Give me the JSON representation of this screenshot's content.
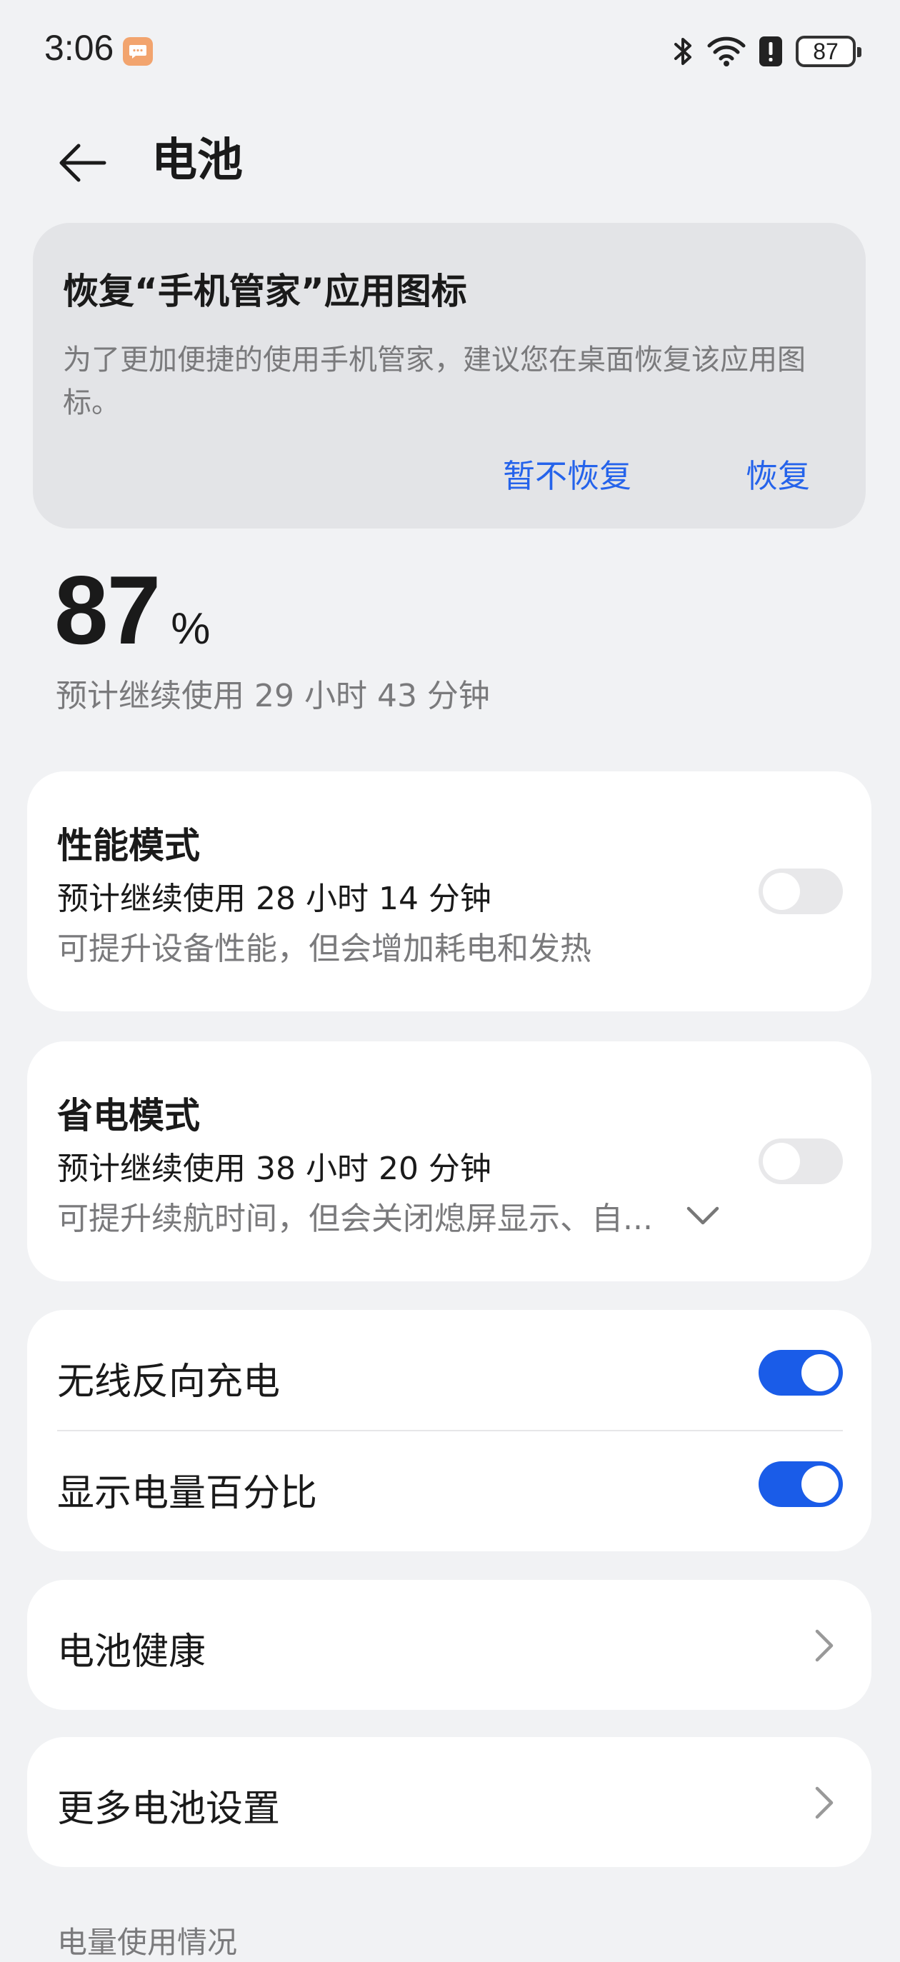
{
  "status_bar": {
    "time": "3:06",
    "battery": "87",
    "icons": [
      "message-app-icon",
      "bluetooth-icon",
      "wifi-icon",
      "alert-icon",
      "battery-icon"
    ]
  },
  "header": {
    "title": "电池",
    "back_icon": "arrow-left-icon"
  },
  "restore_card": {
    "title": "恢复“手机管家”应用图标",
    "description": "为了更加便捷的使用手机管家，建议您在桌面恢复该应用图标。",
    "later_label": "暂不恢复",
    "restore_label": "恢复"
  },
  "battery": {
    "percent": "87",
    "percent_sign": "%",
    "estimate": "预计继续使用 29 小时 43 分钟"
  },
  "performance_mode": {
    "title": "性能模式",
    "estimate": "预计继续使用 28 小时 14 分钟",
    "description": "可提升设备性能，但会增加耗电和发热",
    "enabled": false
  },
  "power_saving_mode": {
    "title": "省电模式",
    "estimate": "预计继续使用 38 小时 20 分钟",
    "description": "可提升续航时间，但会关闭熄屏显示、自...",
    "enabled": false
  },
  "toggles": {
    "reverse_charging": {
      "label": "无线反向充电",
      "enabled": true
    },
    "show_percentage": {
      "label": "显示电量百分比",
      "enabled": true
    }
  },
  "links": {
    "battery_health": "电池健康",
    "more_settings": "更多电池设置"
  },
  "section": {
    "usage_label": "电量使用情况"
  },
  "colors": {
    "accent": "#1a5ce8",
    "link": "#2563eb",
    "background": "#f1f2f4",
    "card": "#ffffff",
    "banner": "#e3e4e7"
  }
}
